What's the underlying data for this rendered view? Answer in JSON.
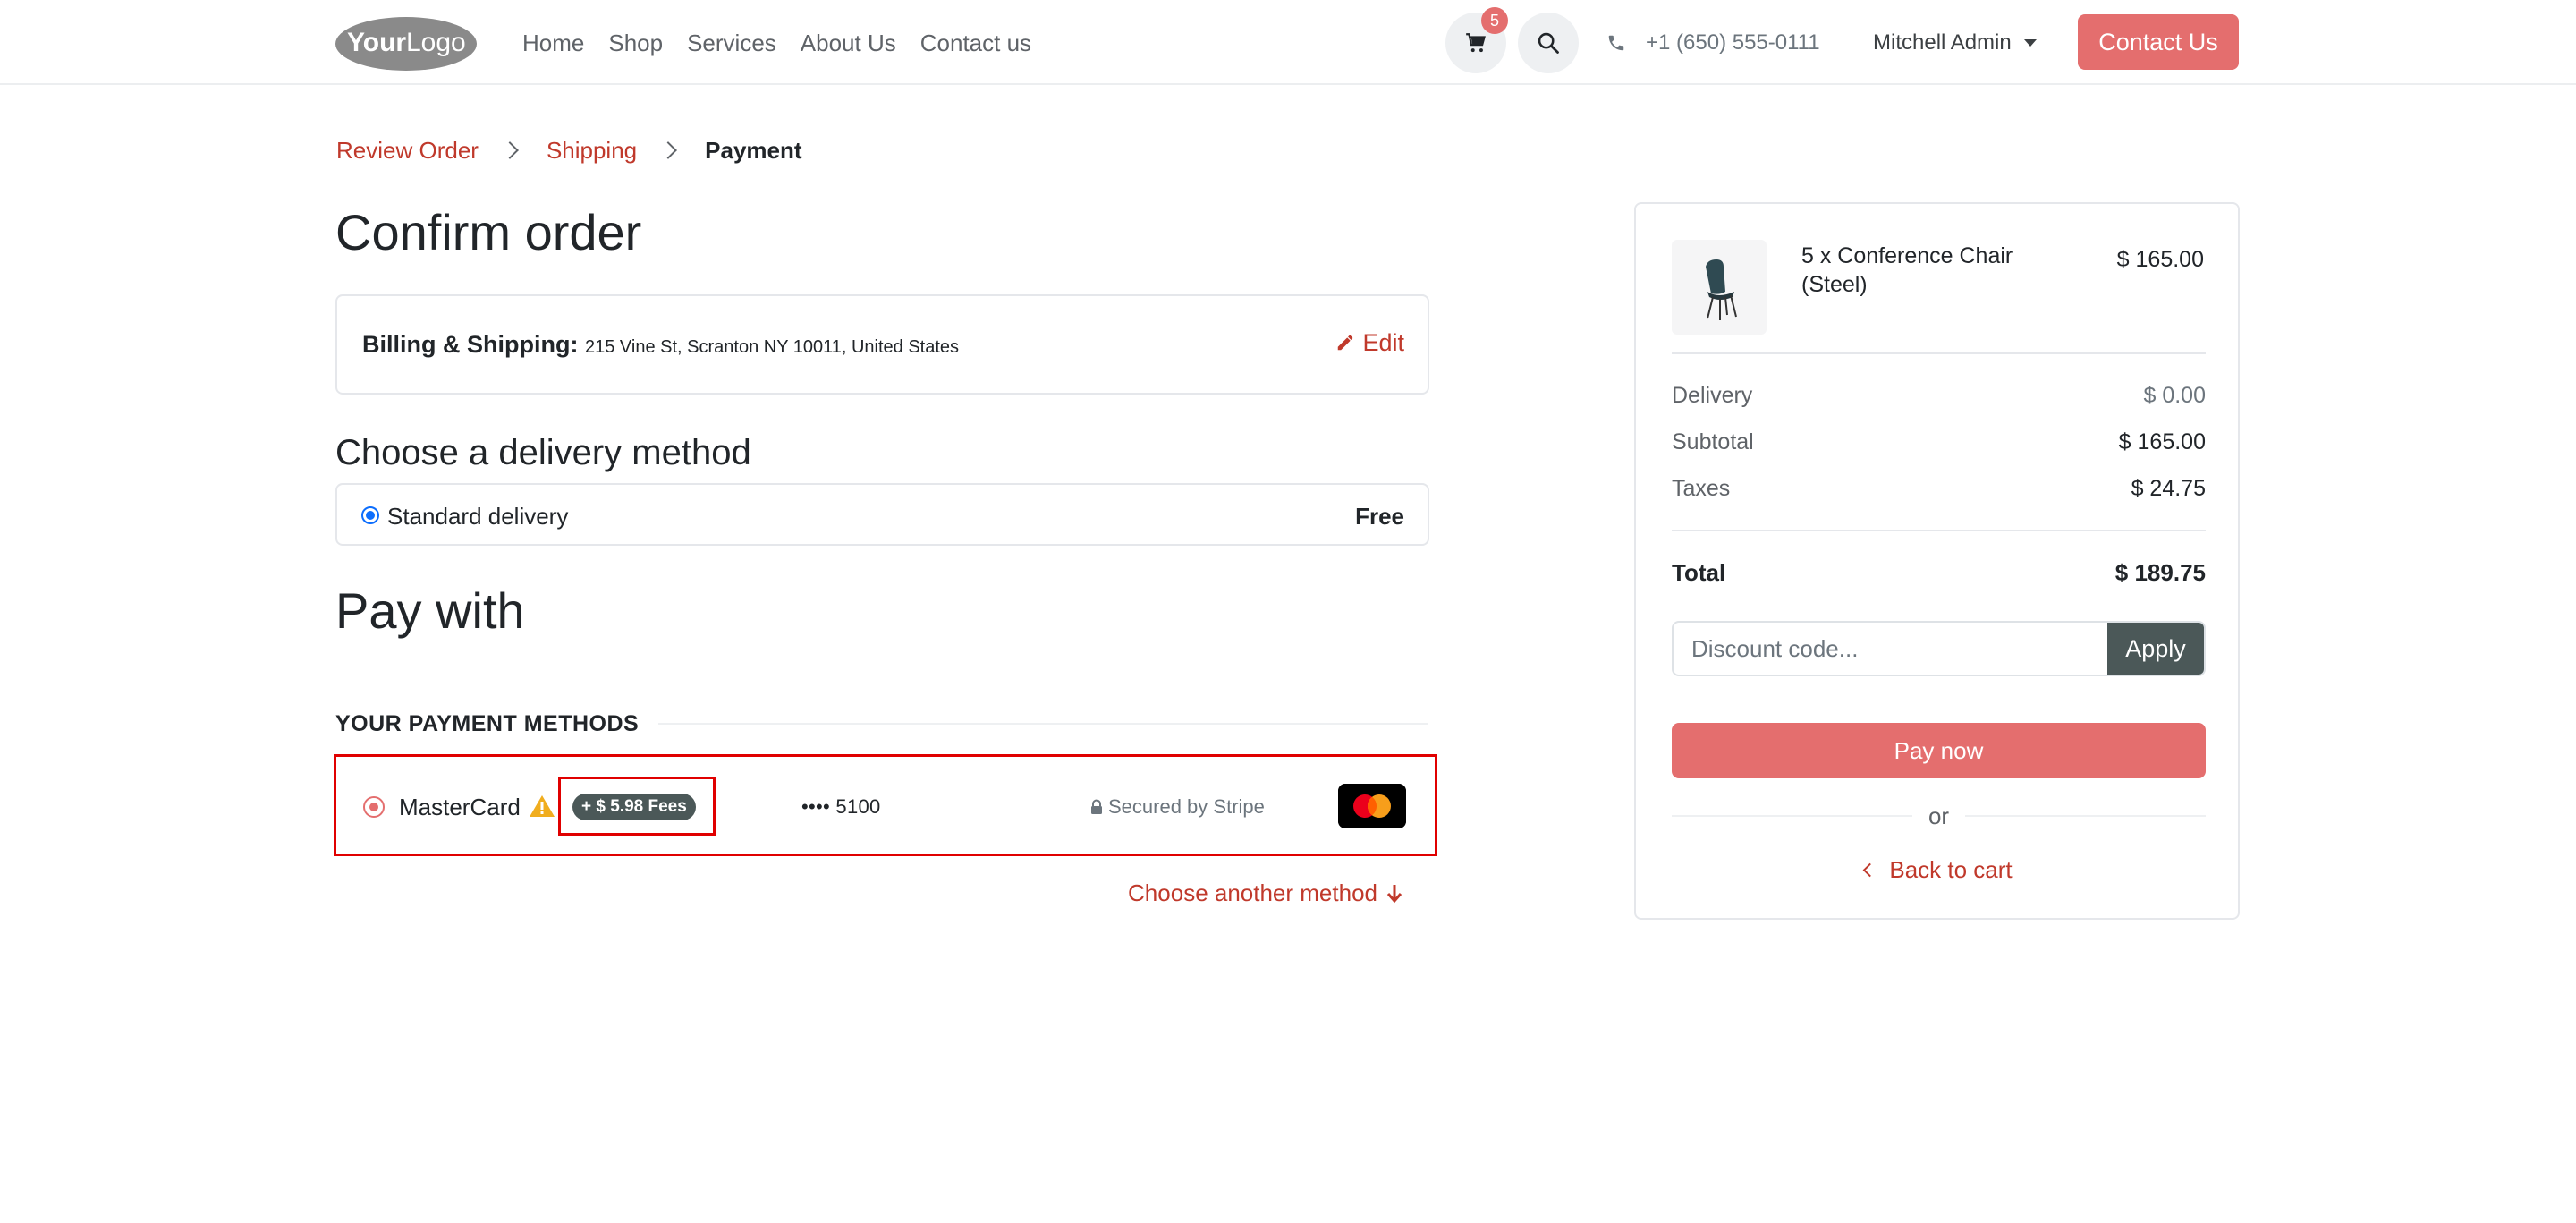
{
  "header": {
    "logo_alt": "YourLogo",
    "nav": [
      "Home",
      "Shop",
      "Services",
      "About Us",
      "Contact us"
    ],
    "cart_count": "5",
    "phone": "+1 (650) 555-0111",
    "user_name": "Mitchell Admin",
    "contact_button": "Contact Us"
  },
  "breadcrumb": {
    "review": "Review Order",
    "shipping": "Shipping",
    "payment": "Payment"
  },
  "page_title": "Confirm order",
  "billing": {
    "label": "Billing & Shipping:",
    "address": "215 Vine St, Scranton NY 10011, United States",
    "edit": "Edit"
  },
  "delivery": {
    "heading": "Choose a delivery method",
    "method_name": "Standard delivery",
    "method_price": "Free"
  },
  "payment": {
    "heading": "Pay with",
    "methods_heading": "YOUR PAYMENT METHODS",
    "method_name": "MasterCard",
    "fee": "+ $ 5.98 Fees",
    "card_mask": "•••• 5100",
    "secured": "Secured by Stripe",
    "choose_another": "Choose another method"
  },
  "summary": {
    "product_name": "5 x Conference Chair (Steel)",
    "product_price": "$ 165.00",
    "delivery_label": "Delivery",
    "delivery_value": "$ 0.00",
    "subtotal_label": "Subtotal",
    "subtotal_value": "$ 165.00",
    "taxes_label": "Taxes",
    "taxes_value": "$ 24.75",
    "total_label": "Total",
    "total_value": "$ 189.75",
    "discount_placeholder": "Discount code...",
    "apply": "Apply",
    "pay_now": "Pay now",
    "or": "or",
    "back_to_cart": "Back to cart"
  },
  "colors": {
    "primary": "#e46e6e",
    "link": "#c0392b",
    "dark_button": "#4b5858",
    "highlight_box": "#e00000"
  }
}
